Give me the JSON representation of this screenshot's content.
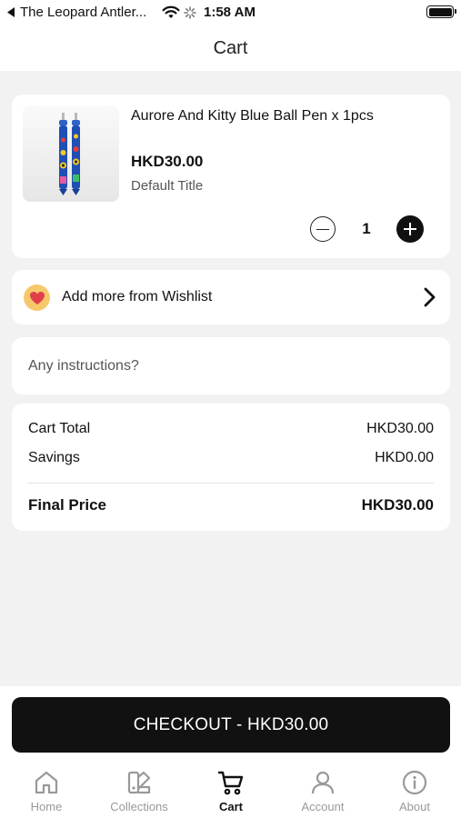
{
  "status_bar": {
    "back_app": "The Leopard Antler...",
    "time": "1:58 AM"
  },
  "header": {
    "title": "Cart"
  },
  "cart_item": {
    "title": "Aurore And Kitty Blue Ball Pen x 1pcs",
    "price": "HKD30.00",
    "variant": "Default Title",
    "quantity": "1"
  },
  "wishlist": {
    "label": "Add more from Wishlist"
  },
  "instructions": {
    "placeholder": "Any instructions?"
  },
  "summary": {
    "cart_total_label": "Cart Total",
    "cart_total_value": "HKD30.00",
    "savings_label": "Savings",
    "savings_value": "HKD0.00",
    "final_label": "Final Price",
    "final_value": "HKD30.00"
  },
  "checkout": {
    "label": "CHECKOUT - HKD30.00"
  },
  "tabs": [
    {
      "label": "Home",
      "icon": "home-icon"
    },
    {
      "label": "Collections",
      "icon": "collections-icon"
    },
    {
      "label": "Cart",
      "icon": "cart-icon",
      "active": true
    },
    {
      "label": "Account",
      "icon": "account-icon"
    },
    {
      "label": "About",
      "icon": "info-icon"
    }
  ],
  "colors": {
    "background": "#f2f2f2",
    "card": "#ffffff",
    "primary": "#111111",
    "inactive_tab": "#999999",
    "wishlist_badge": "#f7c86b",
    "heart": "#e0404a"
  }
}
